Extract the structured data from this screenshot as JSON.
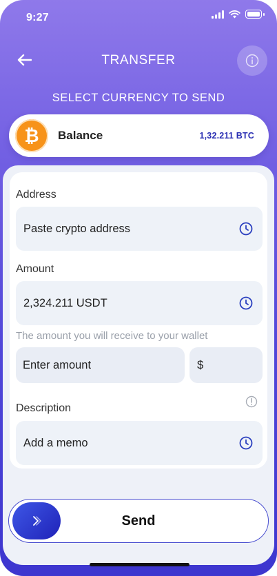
{
  "status": {
    "time": "9:27"
  },
  "header": {
    "title": "TRANSFER"
  },
  "subtitle": "SELECT CURRENCY TO SEND",
  "balance": {
    "label": "Balance",
    "value": "1,32.211 BTC",
    "coin_symbol": "₿",
    "coin_color": "#f7931a"
  },
  "form": {
    "address": {
      "label": "Address",
      "placeholder": "Paste crypto address",
      "icon": "clock-icon"
    },
    "amount": {
      "label": "Amount",
      "value": "2,324.211 USDT",
      "icon": "clock-icon"
    },
    "receive_hint": "The amount you will receive to your wallet",
    "receive_amount": {
      "placeholder": "Enter amount"
    },
    "currency": {
      "value": "$"
    },
    "description": {
      "label": "Description",
      "placeholder": "Add a memo",
      "icon": "clock-icon",
      "info_icon": "info-icon"
    }
  },
  "send": {
    "label": "Send",
    "icon": "chevron-right-icon"
  },
  "colors": {
    "accent": "#5147d9",
    "icon_blue": "#2a3fbf",
    "btc_orange": "#f7931a"
  }
}
